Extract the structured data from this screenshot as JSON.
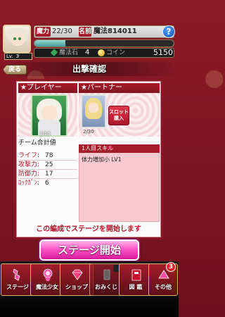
{
  "header": {
    "level_label": "Lv.",
    "level_value": "3",
    "mana_label": "魔力",
    "mana_value": "22/30",
    "name_label": "名前",
    "name_value": "魔法814011",
    "help_label": "?",
    "crystal_label": "魔法石",
    "crystal_value": "4",
    "coin_label": "コイン",
    "coin_value": "5150",
    "xp_fraction": 0.22
  },
  "nav_top": {
    "back_label": "戻る",
    "title": "出撃確認"
  },
  "party": {
    "player_header": "★プレイヤー",
    "partner_header": "★パートナー",
    "player_cost": "3/15",
    "partner_cost": "2/30",
    "slot_buy_label_1": "スロット",
    "slot_buy_label_2": "購入"
  },
  "stats": {
    "title": "チーム合計値",
    "rows": [
      {
        "label": "ライフ:",
        "value": "78"
      },
      {
        "label": "攻撃力:",
        "value": "25"
      },
      {
        "label": "防御力:",
        "value": "17"
      },
      {
        "label": "ﾛｯｸｶﾞﾝ:",
        "value": "6"
      }
    ]
  },
  "skill": {
    "header": "1人目スキル",
    "line": "体力増加小 LV1"
  },
  "message": "この編成でステージを開始します",
  "start_button": "ステージ開始",
  "bottom_nav": {
    "items": [
      {
        "label": "ステージ"
      },
      {
        "label": "魔法少女"
      },
      {
        "label": "ショップ"
      },
      {
        "label": "おみくじ"
      },
      {
        "label": "図 鑑"
      },
      {
        "label": "その他"
      }
    ],
    "prep_badge": "準備中",
    "other_count": "3"
  },
  "colors": {
    "accent_red": "#a51c2a",
    "start_pink": "#ff54c8",
    "gold": "#d8b76a"
  }
}
